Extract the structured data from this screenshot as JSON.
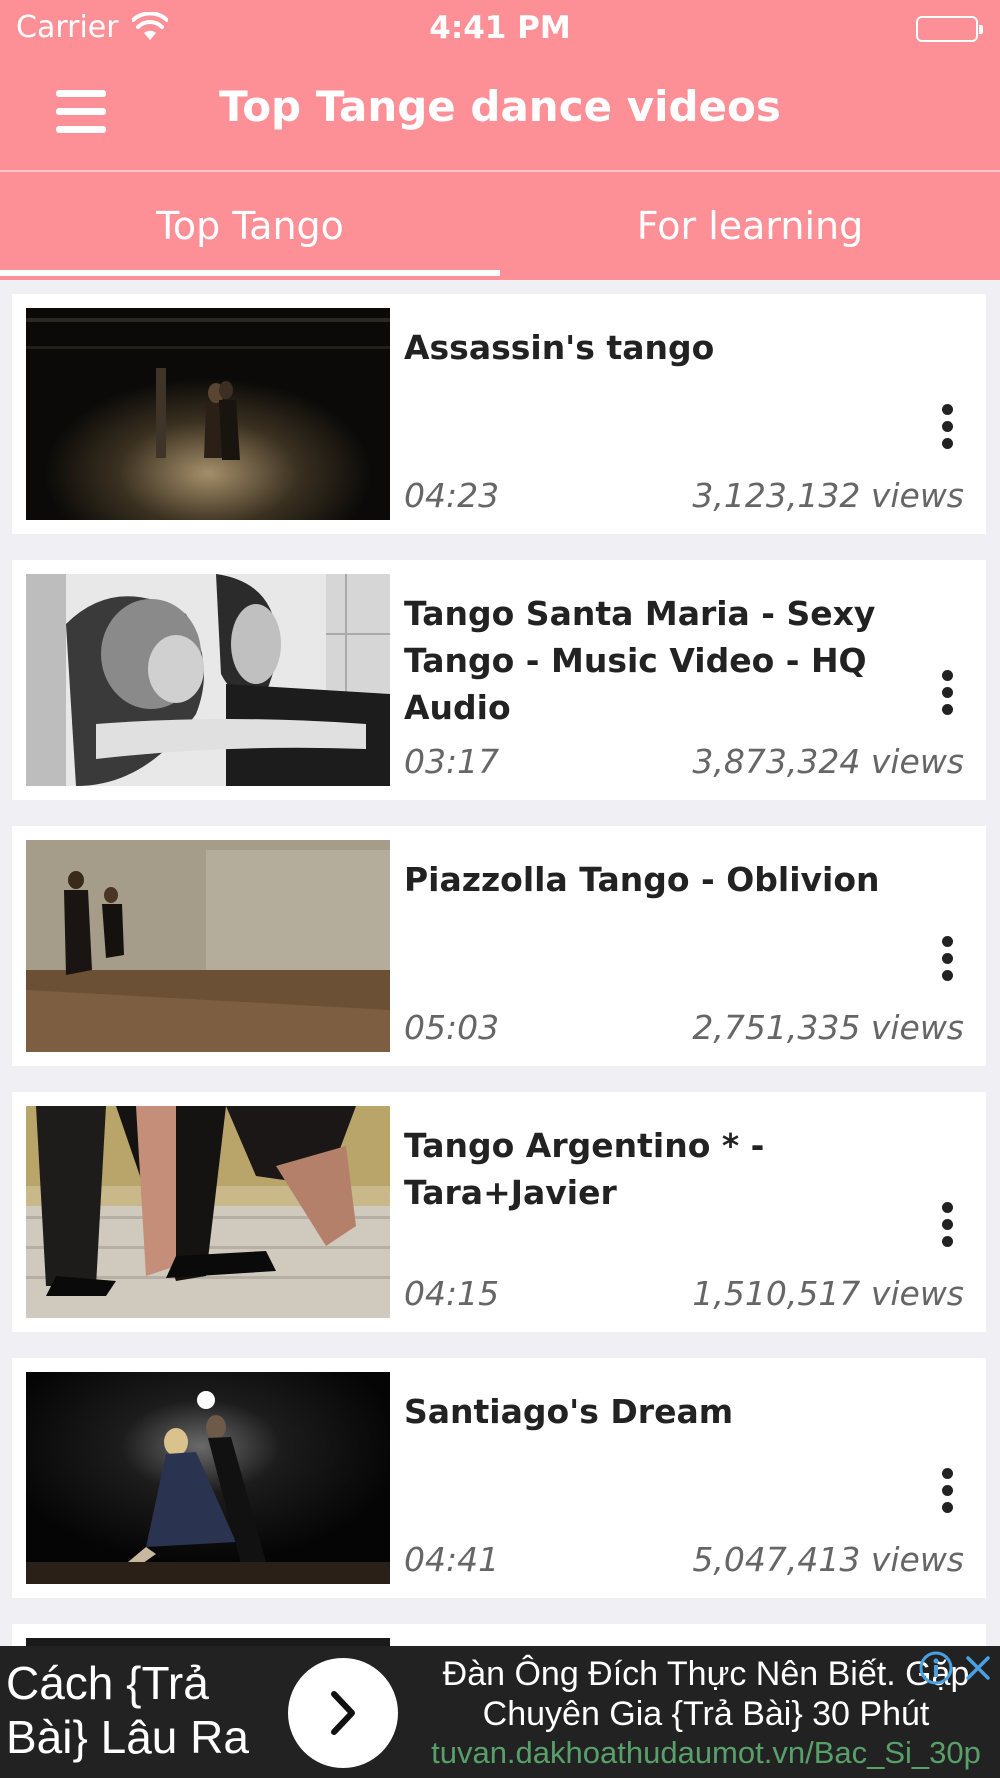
{
  "status_bar": {
    "carrier": "Carrier",
    "wifi_icon": "wifi-icon",
    "time": "4:41 PM",
    "battery_icon": "battery-full-icon"
  },
  "nav": {
    "menu_icon": "hamburger-menu-icon",
    "title": "Top Tange dance videos"
  },
  "tabs": [
    {
      "label": "Top Tango",
      "active": true
    },
    {
      "label": "For learning",
      "active": false
    }
  ],
  "videos": [
    {
      "title": "Assassin's tango",
      "duration": "04:23",
      "views": "3,123,132 views"
    },
    {
      "title": "Tango Santa Maria - Sexy Tango - Music Video - HQ Audio",
      "duration": "03:17",
      "views": "3,873,324 views"
    },
    {
      "title": "Piazzolla Tango - Oblivion",
      "duration": "05:03",
      "views": "2,751,335 views"
    },
    {
      "title": "Tango Argentino * - Tara+Javier",
      "duration": "04:15",
      "views": "1,510,517 views"
    },
    {
      "title": "Santiago's Dream",
      "duration": "04:41",
      "views": "5,047,413 views"
    }
  ],
  "ad": {
    "left_text_line1": "Cách {Trả",
    "left_text_line2": "Bài} Lâu Ra",
    "headline_line1": "Đàn Ông Đích Thực Nên Biết. Gặp",
    "headline_line2": "Chuyên Gia {Trả Bài} 30 Phút",
    "url": "tuvan.dakhoathudaumot.vn/Bac_Si_30p"
  },
  "colors": {
    "brand": "#fd8f97",
    "background": "#efeff4",
    "ad_url": "#58a06a"
  }
}
